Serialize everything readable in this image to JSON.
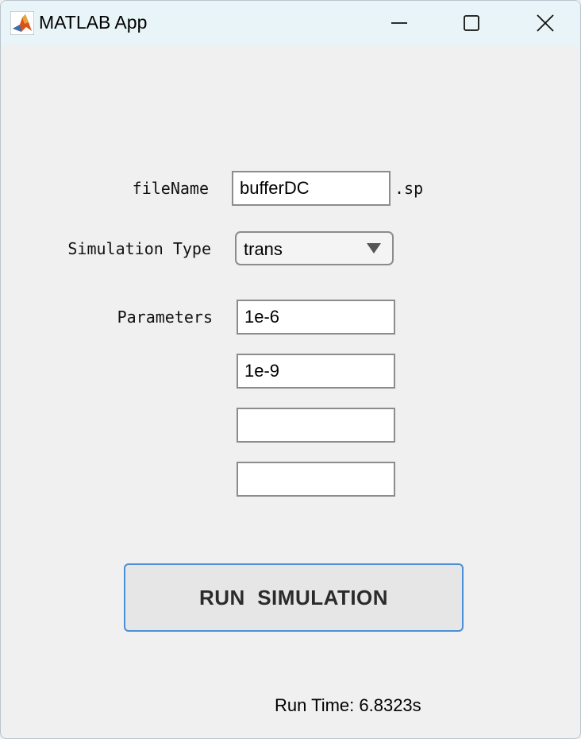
{
  "window": {
    "title": "MATLAB App",
    "icon": "matlab-logo-icon",
    "controls": [
      "minimize-icon",
      "maximize-icon",
      "close-icon"
    ]
  },
  "form": {
    "filename": {
      "label": "fileName",
      "value": "bufferDC",
      "suffix": ".sp"
    },
    "simulation_type": {
      "label": "Simulation Type",
      "selected": "trans"
    },
    "parameters": {
      "label": "Parameters",
      "values": [
        "1e-6",
        "1e-9",
        "",
        ""
      ]
    }
  },
  "run_button": {
    "label": "RUN  SIMULATION",
    "border_color": "#4a8fd6"
  },
  "status": {
    "run_time": "Run Time: 6.8323s"
  }
}
